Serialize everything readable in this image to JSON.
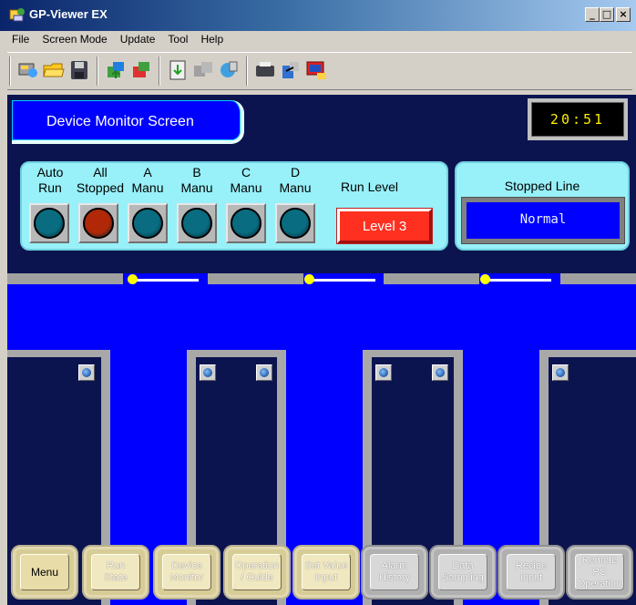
{
  "window": {
    "title": "GP-Viewer EX",
    "minimize": "_",
    "maximize": "□",
    "close": "×"
  },
  "menu": [
    "File",
    "Screen Mode",
    "Update",
    "Tool",
    "Help"
  ],
  "toolbar_icons": [
    "connect-icon",
    "open-folder-icon",
    "save-icon",
    "upload-icon",
    "download-icon",
    "transfer-icon",
    "copy-icon",
    "settings-icon",
    "print-icon",
    "camera-icon",
    "exit-icon"
  ],
  "screen": {
    "header": "Device Monitor Screen",
    "clock": "20:51",
    "lamps": [
      {
        "label1": "Auto",
        "label2": "Run",
        "color": "#0a6c80"
      },
      {
        "label1": "All",
        "label2": "Stopped",
        "color": "#b02808"
      },
      {
        "label1": "A",
        "label2": "Manu",
        "color": "#0a6c80"
      },
      {
        "label1": "B",
        "label2": "Manu",
        "color": "#0a6c80"
      },
      {
        "label1": "C",
        "label2": "Manu",
        "color": "#0a6c80"
      },
      {
        "label1": "D",
        "label2": "Manu",
        "color": "#0a6c80"
      }
    ],
    "run_level_label": "Run Level",
    "run_level_value": "Level 3",
    "stopped_line_label": "Stopped Line",
    "stopped_line_value": "Normal"
  },
  "nav": [
    {
      "l1": "Menu",
      "l2": "",
      "l3": ""
    },
    {
      "l1": "Run",
      "l2": "State",
      "l3": ""
    },
    {
      "l1": "Device",
      "l2": "Monitor",
      "l3": ""
    },
    {
      "l1": "Operation",
      "l2": "/ Guide",
      "l3": ""
    },
    {
      "l1": "Set Value",
      "l2": "Input",
      "l3": ""
    },
    {
      "l1": "Alarm",
      "l2": "History",
      "l3": ""
    },
    {
      "l1": "Data",
      "l2": "Sampling",
      "l3": ""
    },
    {
      "l1": "Recipe",
      "l2": "Input",
      "l3": ""
    },
    {
      "l1": "Remote",
      "l2": "PC",
      "l3": "Operation"
    }
  ]
}
